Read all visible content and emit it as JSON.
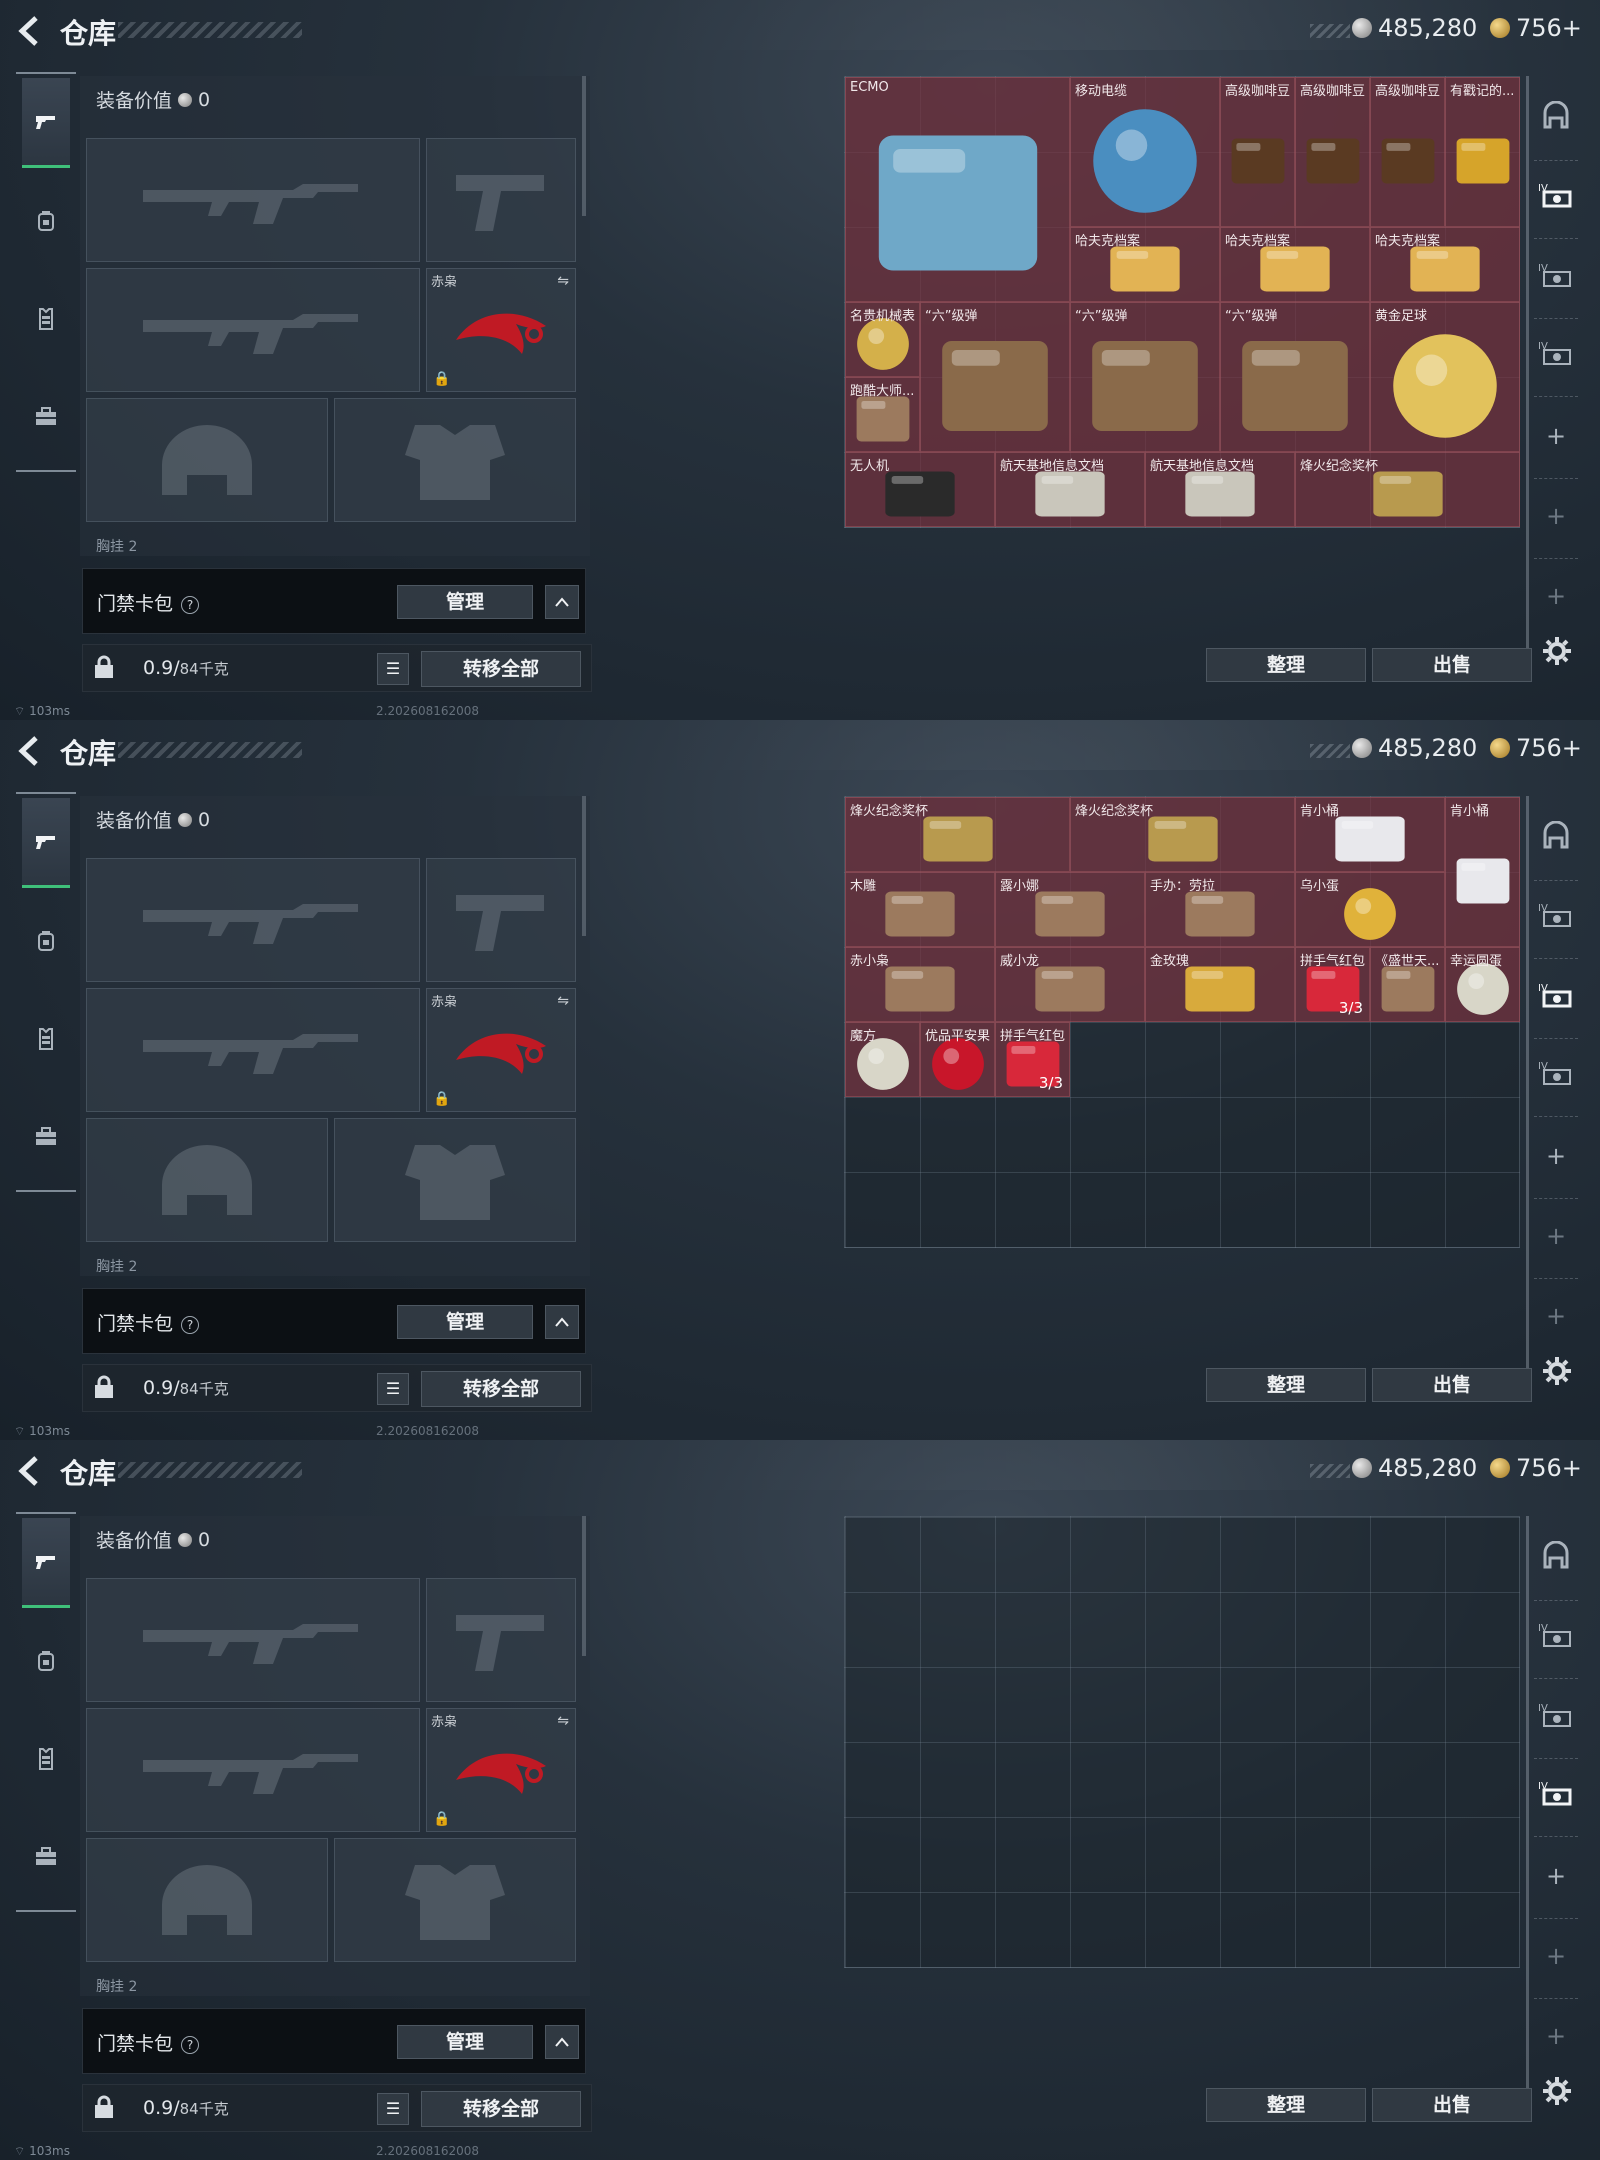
{
  "header": {
    "title": "仓库",
    "silver": "485,280",
    "gold": "756+"
  },
  "equipment": {
    "value_label": "装备价值",
    "value": "0",
    "knife_label": "赤枭",
    "chest_label": "胸挂 2"
  },
  "card_pack": {
    "label": "门禁卡包",
    "help": "?",
    "manage": "管理",
    "collapse": "^"
  },
  "capacity": {
    "value": "0.9/",
    "max": "84千克",
    "transfer_all": "转移全部"
  },
  "footer": {
    "organize": "整理",
    "sell": "出售"
  },
  "status": {
    "ping": "103ms",
    "build": "2.202608162008"
  },
  "side_tools": {
    "tier": "IV",
    "plus": "+"
  },
  "panels": [
    {
      "items": [
        {
          "name": "ECMO",
          "count": "",
          "color": "#7a3441"
        },
        {
          "name": "移动电缆",
          "count": "",
          "color": "#7a3441"
        },
        {
          "name": "高级咖啡豆",
          "count": "",
          "color": "#7a3441"
        },
        {
          "name": "高级咖啡豆",
          "count": "",
          "color": "#7a3441"
        },
        {
          "name": "高级咖啡豆",
          "count": "",
          "color": "#7a3441"
        },
        {
          "name": "有戳记的...",
          "count": "",
          "color": "#7a3441"
        },
        {
          "name": "哈夫克档案",
          "count": "",
          "color": "#7a3441"
        },
        {
          "name": "哈夫克档案",
          "count": "",
          "color": "#7a3441"
        },
        {
          "name": "哈夫克档案",
          "count": "",
          "color": "#7a3441"
        },
        {
          "name": "名贵机械表",
          "count": "",
          "color": "#7a3441"
        },
        {
          "name": "跑酷大师...",
          "count": "",
          "color": "#7a3441"
        },
        {
          "name": "“六”级弹",
          "count": "",
          "color": "#7a3441"
        },
        {
          "name": "“六”级弹",
          "count": "",
          "color": "#7a3441"
        },
        {
          "name": "“六”级弹",
          "count": "",
          "color": "#7a3441"
        },
        {
          "name": "黄金足球",
          "count": "",
          "color": "#7a3441"
        },
        {
          "name": "无人机",
          "count": "",
          "color": "#7a3441"
        },
        {
          "name": "航天基地信息文档",
          "count": "",
          "color": "#7a3441"
        },
        {
          "name": "航天基地信息文档",
          "count": "",
          "color": "#7a3441"
        },
        {
          "name": "烽火纪念奖杯",
          "count": "",
          "color": "#7a3441"
        }
      ]
    },
    {
      "items": [
        {
          "name": "烽火纪念奖杯",
          "count": "",
          "color": "#7a3441"
        },
        {
          "name": "烽火纪念奖杯",
          "count": "",
          "color": "#7a3441"
        },
        {
          "name": "肯小桶",
          "count": "",
          "color": "#7a3441"
        },
        {
          "name": "肯小桶",
          "count": "",
          "color": "#7a3441"
        },
        {
          "name": "木雕",
          "count": "",
          "color": "#7a3441"
        },
        {
          "name": "露小娜",
          "count": "",
          "color": "#7a3441"
        },
        {
          "name": "手办：劳拉",
          "count": "",
          "color": "#7a3441"
        },
        {
          "name": "乌小蛋",
          "count": "",
          "color": "#7a3441"
        },
        {
          "name": "赤小枭",
          "count": "",
          "color": "#7a3441"
        },
        {
          "name": "威小龙",
          "count": "",
          "color": "#7a3441"
        },
        {
          "name": "金玫瑰",
          "count": "",
          "color": "#7a3441"
        },
        {
          "name": "拼手气红包",
          "count": "3/3",
          "color": "#7a3441"
        },
        {
          "name": "《盛世天...",
          "count": "",
          "color": "#7a3441"
        },
        {
          "name": "幸运圆蛋",
          "count": "",
          "color": "#7a3441"
        },
        {
          "name": "魔方",
          "count": "",
          "color": "#7a3441"
        },
        {
          "name": "优品平安果",
          "count": "",
          "color": "#7a3441"
        },
        {
          "name": "拼手气红包",
          "count": "3/3",
          "color": "#7a3441"
        }
      ]
    },
    {
      "items": []
    }
  ]
}
